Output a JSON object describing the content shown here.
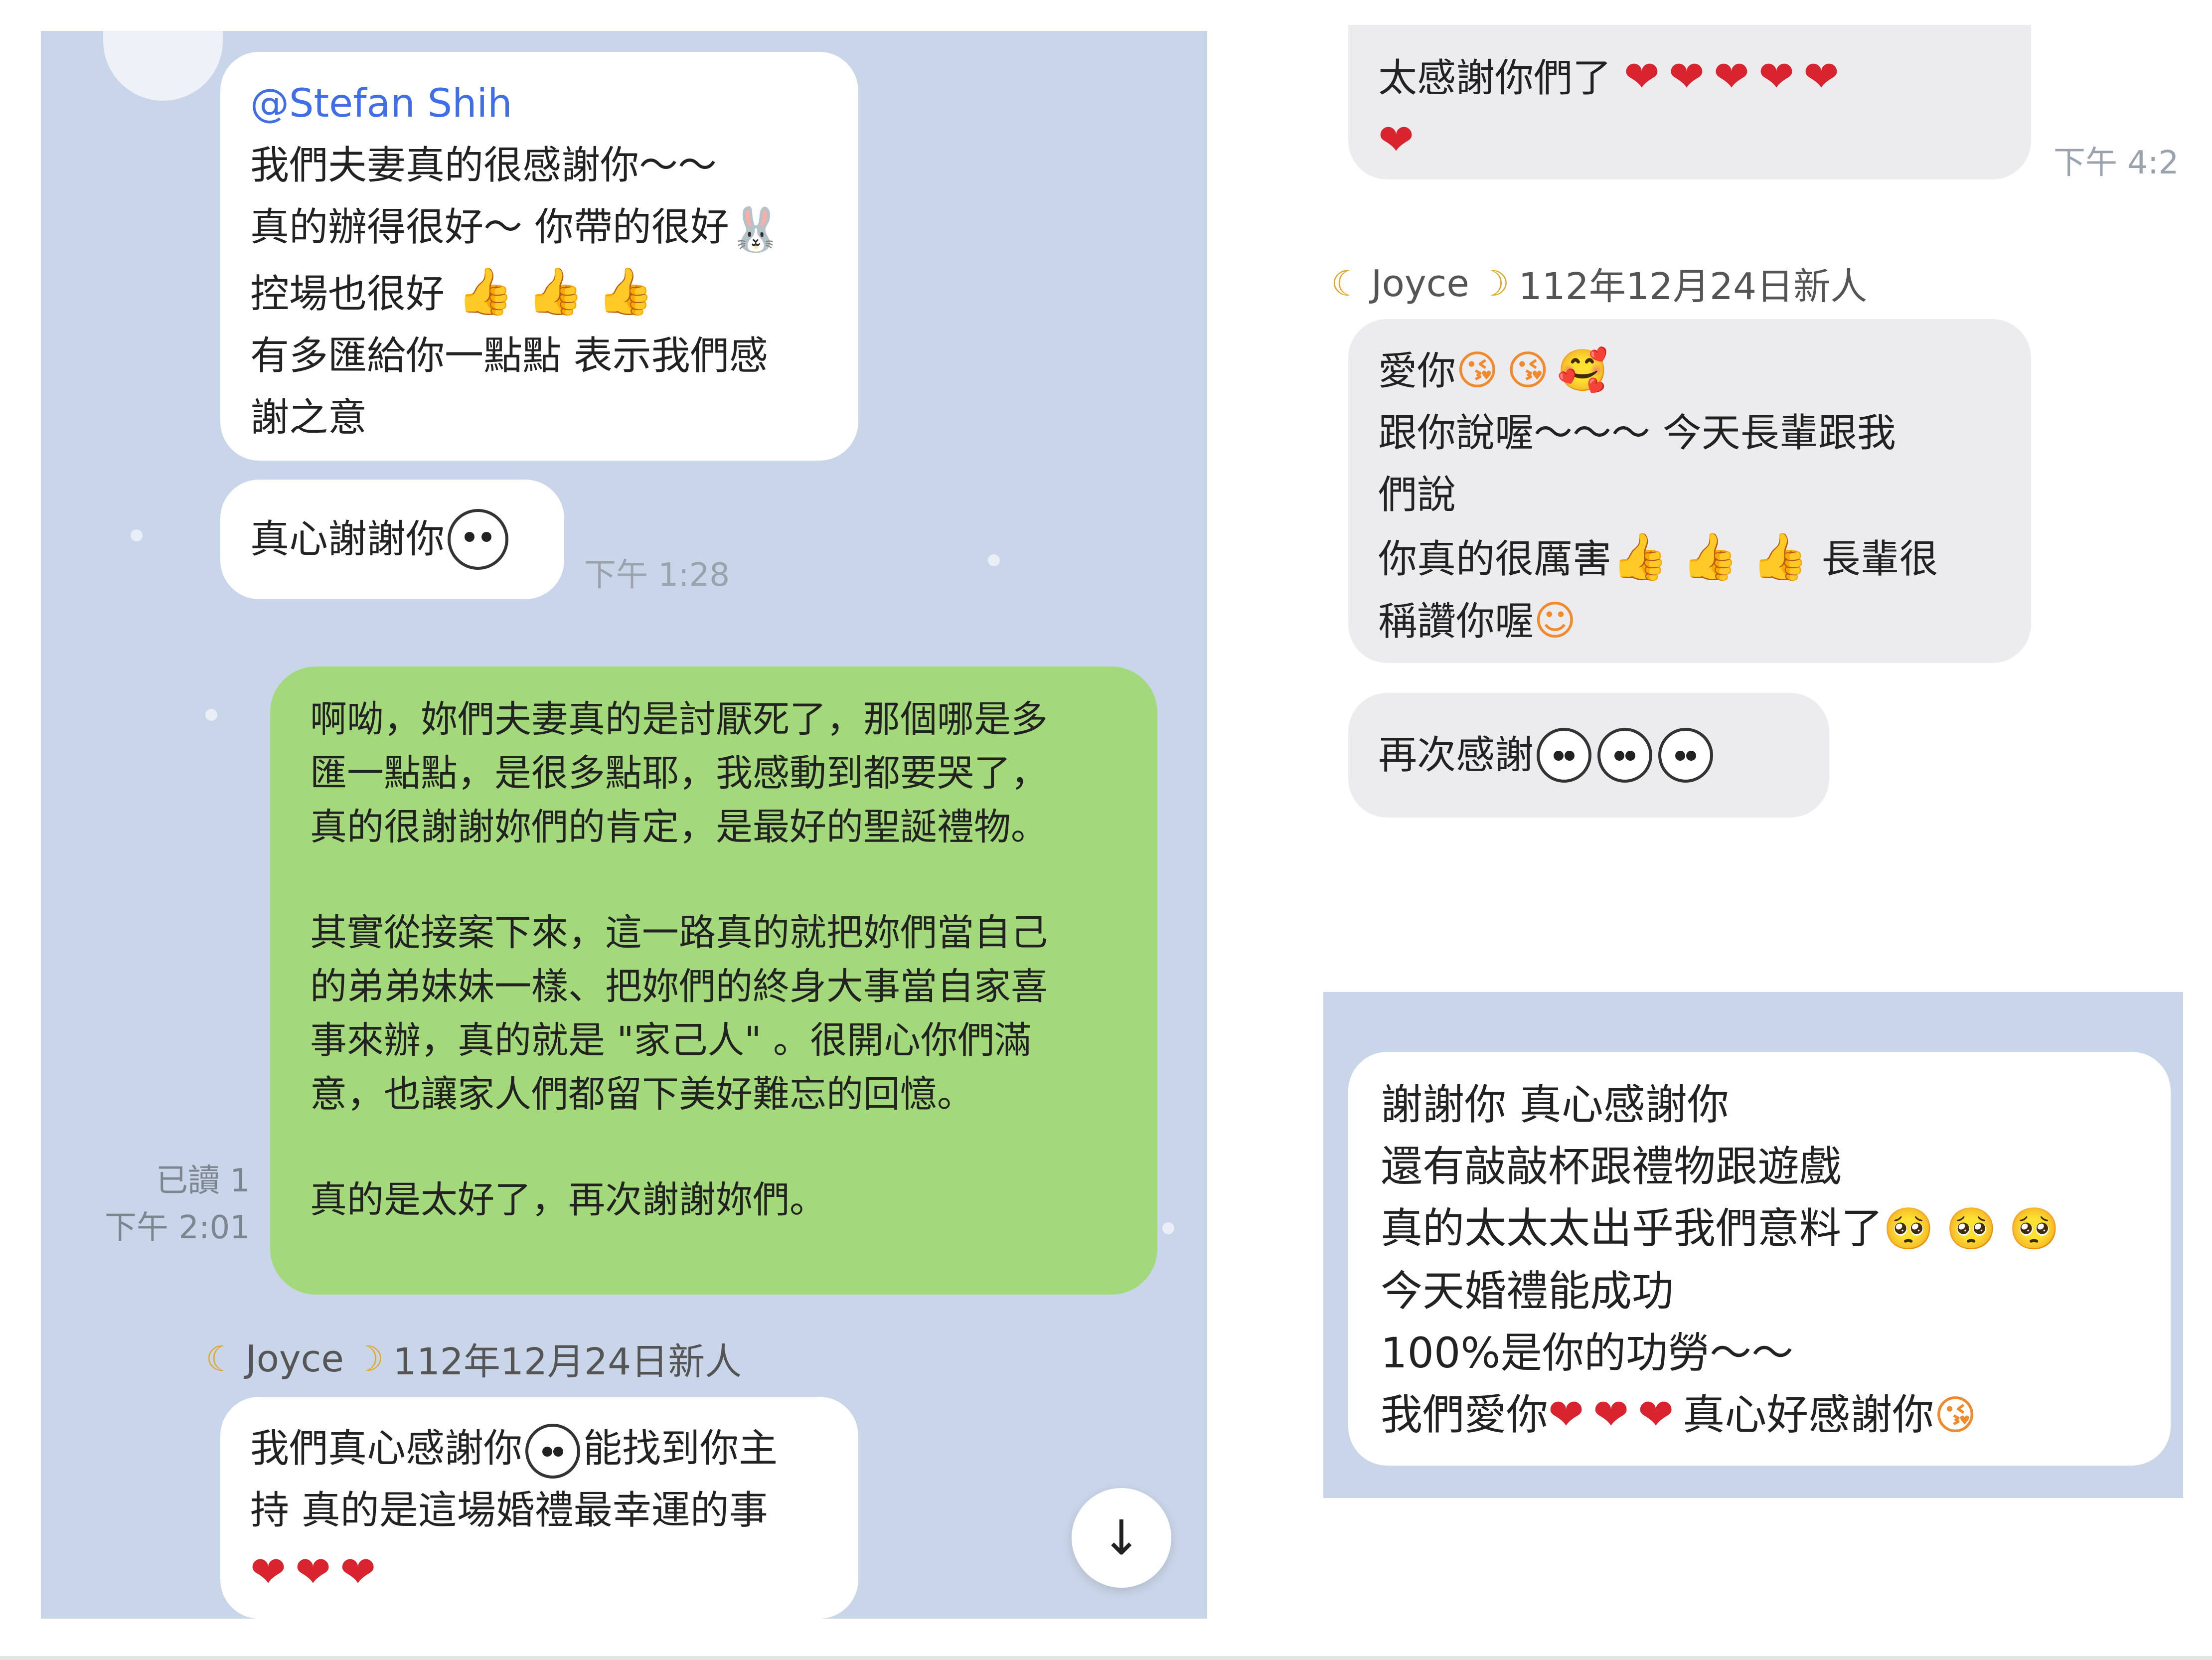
{
  "left_chat": {
    "msg1": {
      "mention": "@Stefan Shih",
      "lines": [
        "我們夫妻真的很感謝你～～",
        "真的辦得很好～ 你帶的很好",
        "控場也很好",
        "有多匯給你一點點 表示我們感",
        "謝之意"
      ],
      "icons": [
        "bunny-face-icon",
        "thumbs-up-icon"
      ]
    },
    "msg2": {
      "text": "真心謝謝你",
      "time": "下午 1:28",
      "icon": "panda-face-icon"
    },
    "msg3": {
      "para1": [
        "啊呦，妳們夫妻真的是討厭死了，那個哪是多",
        "匯一點點，是很多點耶，我感動到都要哭了，",
        "真的很謝謝妳們的肯定，是最好的聖誕禮物。"
      ],
      "para2": [
        "其實從接案下來，這一路真的就把妳們當自己",
        "的弟弟妹妹一樣、把妳們的終身大事當自家喜",
        "事來辦，真的就是 \"家己人\" 。很開心你們滿",
        "意，也讓家人們都留下美好難忘的回憶。"
      ],
      "para3": [
        "真的是太好了，再次謝謝妳們。"
      ],
      "read": "已讀 1",
      "time": "下午 2:01"
    },
    "sender": {
      "name": "Joyce",
      "note": "112年12月24日新人"
    },
    "msg4": {
      "line1": "我們真心感謝你",
      "line1b": "能找到你主",
      "line2": "持 真的是這場婚禮最幸運的事"
    },
    "scroll_icon": "arrow-down-icon"
  },
  "right_chat": {
    "msg1": {
      "text": "太感謝你們了",
      "time": "下午 4:2"
    },
    "sender": {
      "name": "Joyce",
      "note": "112年12月24日新人"
    },
    "msg2": {
      "line1": "愛你",
      "line2": "跟你說喔～～～ 今天長輩跟我",
      "line3": "們說",
      "line4a": "你真的很厲害",
      "line4b": "長輩很",
      "line5": "稱讚你喔"
    },
    "msg3": {
      "text": "再次感謝"
    },
    "msg4": {
      "line1": "謝謝你 真心感謝你",
      "line2": "還有敲敲杯跟禮物跟遊戲",
      "line3": "真的太太太出乎我們意料了",
      "line4": "今天婚禮能成功",
      "line5": "100%是你的功勞～～",
      "line6a": "我們愛你",
      "line6b": "真心好感謝你"
    }
  },
  "colors": {
    "chat_bg": "#c9d5e8",
    "green_bubble": "#a3d97a",
    "mention": "#3f6ee6",
    "heart": "#d9232f"
  }
}
